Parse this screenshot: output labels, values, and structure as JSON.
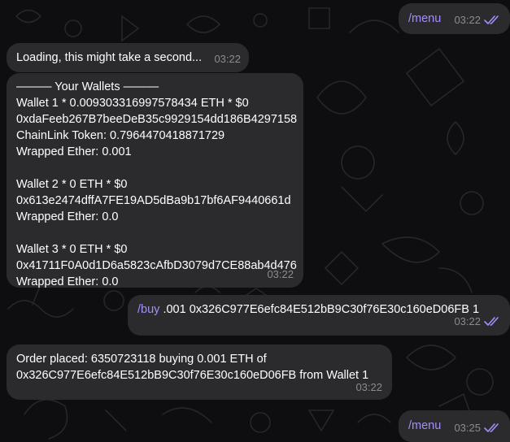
{
  "messages": {
    "menu1": {
      "command": "/menu",
      "time": "03:22"
    },
    "loading": {
      "text": "Loading, this might take a second...",
      "time": "03:22"
    },
    "wallets": {
      "header": "——— Your Wallets ———",
      "wallet1": {
        "title": "Wallet 1 * 0.009303316997578434 ETH * $0",
        "address": "0xdaFeeb267B7beeDeB35c9929154dd186B4297158",
        "token1": "ChainLink Token: 0.7964470418871729",
        "token2": "Wrapped Ether: 0.001"
      },
      "wallet2": {
        "title": "Wallet 2 * 0 ETH * $0",
        "address": "0x613e2474dffA7FE19AD5dBa9b17bf6AF9440661d",
        "token1": "Wrapped Ether: 0.0"
      },
      "wallet3": {
        "title": "Wallet 3 * 0 ETH * $0",
        "address": "0x41711F0A0d1D6a5823cAfbD3079d7CE88ab4d476",
        "token1": "Wrapped Ether: 0.0"
      },
      "time": "03:22"
    },
    "buy": {
      "command": "/buy",
      "args": " .001 0x326C977E6efc84E512bB9C30f76E30c160eD06FB 1",
      "time": "03:22"
    },
    "order": {
      "line1": "Order placed: 6350723118 buying 0.001 ETH of",
      "line2": "0x326C977E6efc84E512bB9C30f76E30c160eD06FB from Wallet 1",
      "time": "03:22"
    },
    "menu2": {
      "command": "/menu",
      "time": "03:25"
    }
  },
  "icons": {
    "read_receipt": "double-check-icon"
  },
  "colors": {
    "background": "#0e0e10",
    "bubble": "#2b2b2e",
    "command": "#a58dfb",
    "time": "#8c8c90"
  }
}
